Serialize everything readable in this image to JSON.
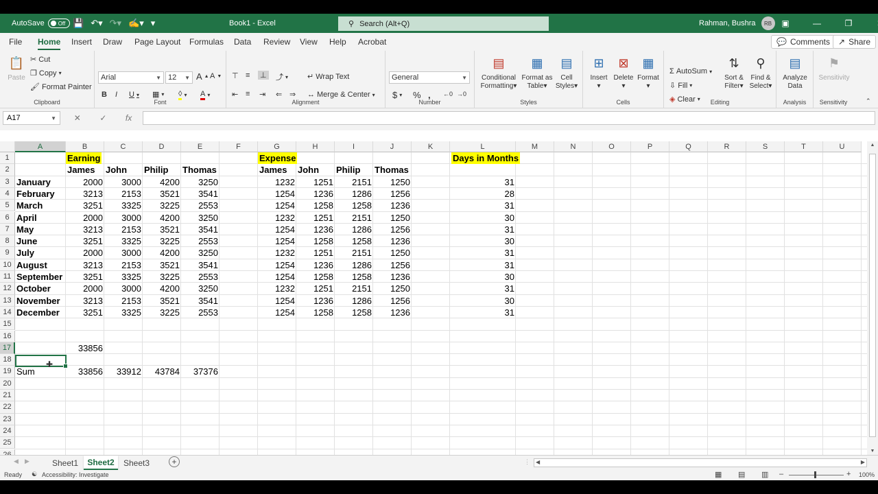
{
  "titlebar": {
    "autosave_label": "AutoSave",
    "autosave_state": "Off",
    "title": "Book1  -  Excel",
    "search_placeholder": "Search (Alt+Q)",
    "user_name": "Rahman, Bushra",
    "user_initials": "RB"
  },
  "menu": {
    "tabs": [
      "File",
      "Home",
      "Insert",
      "Draw",
      "Page Layout",
      "Formulas",
      "Data",
      "Review",
      "View",
      "Help",
      "Acrobat"
    ],
    "active_tab": "Home",
    "comments_label": "Comments",
    "share_label": "Share"
  },
  "ribbon": {
    "clipboard": {
      "paste": "Paste",
      "cut": "Cut",
      "copy": "Copy",
      "format_painter": "Format Painter",
      "label": "Clipboard"
    },
    "font": {
      "name": "Arial",
      "size": "12",
      "label": "Font"
    },
    "alignment": {
      "wrap_text": "Wrap Text",
      "merge_center": "Merge & Center",
      "label": "Alignment"
    },
    "number": {
      "format": "General",
      "label": "Number"
    },
    "styles": {
      "conditional": [
        "Conditional",
        "Formatting"
      ],
      "format_table": [
        "Format as",
        "Table"
      ],
      "cell_styles": [
        "Cell",
        "Styles"
      ],
      "label": "Styles"
    },
    "cells": {
      "insert": "Insert",
      "delete": "Delete",
      "format": "Format",
      "label": "Cells"
    },
    "editing": {
      "autosum": "AutoSum",
      "fill": "Fill",
      "clear": "Clear",
      "sort_filter": [
        "Sort &",
        "Filter"
      ],
      "find_select": [
        "Find &",
        "Select"
      ],
      "label": "Editing"
    },
    "analysis": {
      "analyze": [
        "Analyze",
        "Data"
      ],
      "label": "Analysis"
    },
    "sensitivity": {
      "button": "Sensitivity",
      "label": "Sensitivity"
    }
  },
  "formula_bar": {
    "name_box": "A17",
    "content": ""
  },
  "grid": {
    "columns": [
      "A",
      "B",
      "C",
      "D",
      "E",
      "F",
      "G",
      "H",
      "I",
      "J",
      "K",
      "L",
      "M",
      "N",
      "O",
      "P",
      "Q",
      "R",
      "S",
      "T",
      "U"
    ],
    "rows": [
      "1",
      "2",
      "3",
      "4",
      "5",
      "6",
      "7",
      "8",
      "9",
      "10",
      "11",
      "12",
      "13",
      "14",
      "15",
      "16",
      "17",
      "18",
      "19",
      "20",
      "21",
      "22",
      "23",
      "24",
      "25",
      "26"
    ],
    "selected_cell": "A17",
    "earning_header": "Earning",
    "expense_header": "Expense",
    "days_header": "Days in Months",
    "people": [
      "James",
      "John",
      "Philip",
      "Thomas"
    ],
    "months": [
      "January",
      "February",
      "March",
      "April",
      "May",
      "June",
      "July",
      "August",
      "September",
      "October",
      "November",
      "December"
    ],
    "earnings": [
      [
        "2000",
        "3000",
        "4200",
        "3250"
      ],
      [
        "3213",
        "2153",
        "3521",
        "3541"
      ],
      [
        "3251",
        "3325",
        "3225",
        "2553"
      ],
      [
        "2000",
        "3000",
        "4200",
        "3250"
      ],
      [
        "3213",
        "2153",
        "3521",
        "3541"
      ],
      [
        "3251",
        "3325",
        "3225",
        "2553"
      ],
      [
        "2000",
        "3000",
        "4200",
        "3250"
      ],
      [
        "3213",
        "2153",
        "3521",
        "3541"
      ],
      [
        "3251",
        "3325",
        "3225",
        "2553"
      ],
      [
        "2000",
        "3000",
        "4200",
        "3250"
      ],
      [
        "3213",
        "2153",
        "3521",
        "3541"
      ],
      [
        "3251",
        "3325",
        "3225",
        "2553"
      ]
    ],
    "expenses": [
      [
        "1232",
        "1251",
        "2151",
        "1250"
      ],
      [
        "1254",
        "1236",
        "1286",
        "1256"
      ],
      [
        "1254",
        "1258",
        "1258",
        "1236"
      ],
      [
        "1232",
        "1251",
        "2151",
        "1250"
      ],
      [
        "1254",
        "1236",
        "1286",
        "1256"
      ],
      [
        "1254",
        "1258",
        "1258",
        "1236"
      ],
      [
        "1232",
        "1251",
        "2151",
        "1250"
      ],
      [
        "1254",
        "1236",
        "1286",
        "1256"
      ],
      [
        "1254",
        "1258",
        "1258",
        "1236"
      ],
      [
        "1232",
        "1251",
        "2151",
        "1250"
      ],
      [
        "1254",
        "1236",
        "1286",
        "1256"
      ],
      [
        "1254",
        "1258",
        "1258",
        "1236"
      ]
    ],
    "days": [
      "31",
      "28",
      "31",
      "30",
      "31",
      "30",
      "31",
      "31",
      "30",
      "31",
      "30",
      "31"
    ],
    "b17_value": "33856",
    "sum_label": "Sum",
    "sums": [
      "33856",
      "33912",
      "43784",
      "37376"
    ]
  },
  "sheet_tabs": {
    "tabs": [
      "Sheet1",
      "Sheet2",
      "Sheet3"
    ],
    "active": "Sheet2"
  },
  "status": {
    "ready": "Ready",
    "accessibility": "Accessibility: Investigate",
    "zoom": "100%"
  },
  "colors": {
    "excel_green": "#217346",
    "highlight_yellow": "#ffff00"
  }
}
